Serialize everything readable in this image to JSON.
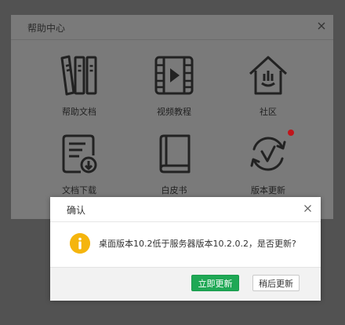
{
  "help_center": {
    "title": "帮助中心",
    "tiles": [
      {
        "label": "帮助文档",
        "icon": "books-icon"
      },
      {
        "label": "视频教程",
        "icon": "video-icon"
      },
      {
        "label": "社区",
        "icon": "community-home-icon"
      },
      {
        "label": "文档下载",
        "icon": "document-download-icon"
      },
      {
        "label": "白皮书",
        "icon": "book-icon"
      },
      {
        "label": "版本更新",
        "icon": "refresh-check-icon",
        "badge": true
      }
    ]
  },
  "confirm_dialog": {
    "title": "确认",
    "message": "桌面版本10.2低于服务器版本10.2.0.2，是否更新?",
    "update_now_label": "立即更新",
    "update_later_label": "稍后更新"
  },
  "colors": {
    "primary_button": "#1fa855",
    "info_icon": "#f5b50d",
    "badge": "#c0151b"
  }
}
